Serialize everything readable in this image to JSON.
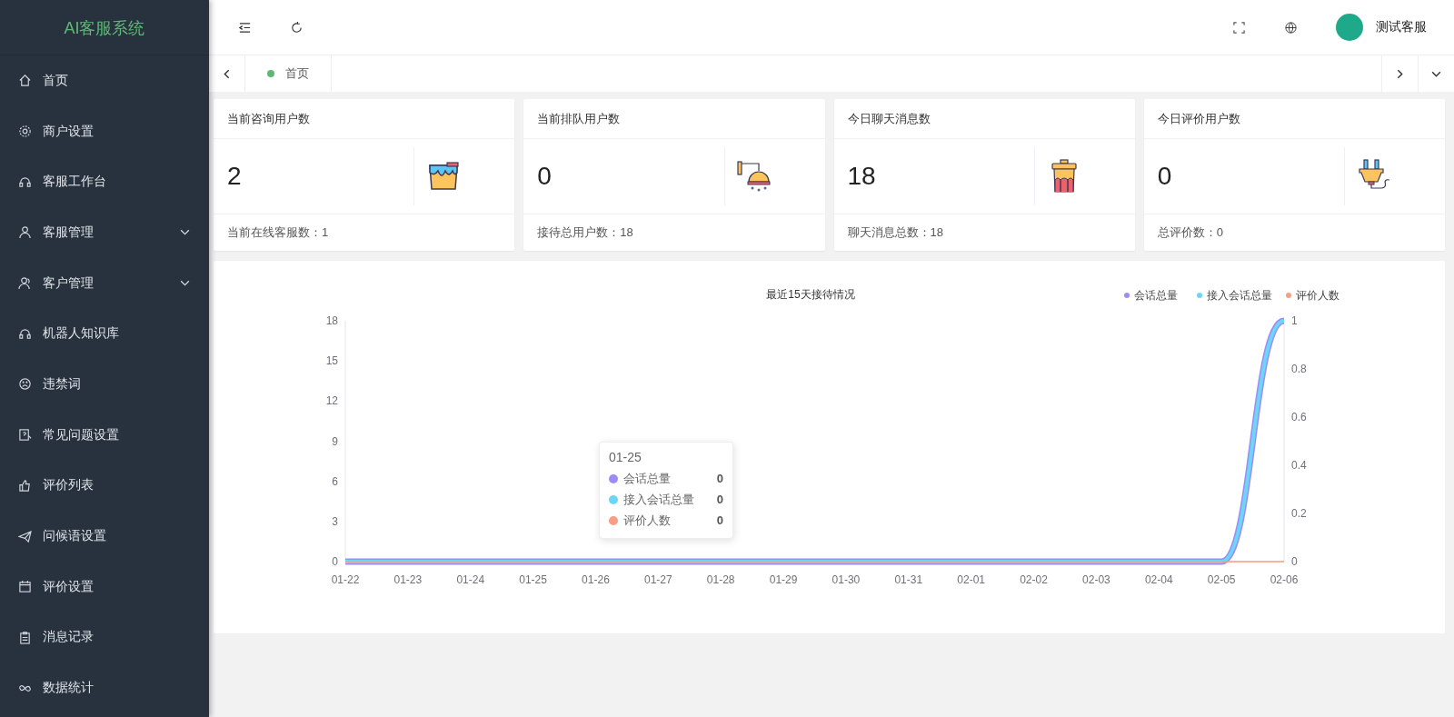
{
  "sidebar": {
    "title": "AI客服系统",
    "items": [
      {
        "label": "首页",
        "expandable": false
      },
      {
        "label": "商户设置",
        "expandable": false
      },
      {
        "label": "客服工作台",
        "expandable": false
      },
      {
        "label": "客服管理",
        "expandable": true
      },
      {
        "label": "客户管理",
        "expandable": true
      },
      {
        "label": "机器人知识库",
        "expandable": false
      },
      {
        "label": "违禁词",
        "expandable": false
      },
      {
        "label": "常见问题设置",
        "expandable": false
      },
      {
        "label": "评价列表",
        "expandable": false
      },
      {
        "label": "问候语设置",
        "expandable": false
      },
      {
        "label": "评价设置",
        "expandable": false
      },
      {
        "label": "消息记录",
        "expandable": false
      },
      {
        "label": "数据统计",
        "expandable": false
      }
    ]
  },
  "header": {
    "user": "测试客服"
  },
  "tabs": [
    {
      "label": "首页",
      "selected": true
    }
  ],
  "cards": [
    {
      "title": "当前咨询用户数",
      "value": "2",
      "footer": "当前在线客服数：1"
    },
    {
      "title": "当前排队用户数",
      "value": "0",
      "footer": "接待总用户数：18"
    },
    {
      "title": "今日聊天消息数",
      "value": "18",
      "footer": "聊天消息总数：18"
    },
    {
      "title": "今日评价用户数",
      "value": "0",
      "footer": "总评价数：0"
    }
  ],
  "chart": {
    "chart_data": {
      "type": "line",
      "title": "最近15天接待情况",
      "legend": "top-right",
      "categories": [
        "01-22",
        "01-23",
        "01-24",
        "01-25",
        "01-26",
        "01-27",
        "01-28",
        "01-29",
        "01-30",
        "01-31",
        "02-01",
        "02-02",
        "02-03",
        "02-04",
        "02-05",
        "02-06"
      ],
      "series": [
        {
          "name": "会话总量",
          "color": "#9d8cf7",
          "values": [
            0,
            0,
            0,
            0,
            0,
            0,
            0,
            0,
            0,
            0,
            0,
            0,
            0,
            0,
            0,
            18
          ]
        },
        {
          "name": "接入会话总量",
          "color": "#6cd6f6",
          "values": [
            0,
            0,
            0,
            0,
            0,
            0,
            0,
            0,
            0,
            0,
            0,
            0,
            0,
            0,
            0,
            18
          ]
        },
        {
          "name": "评价人数",
          "color": "#fb9c86",
          "values": [
            0,
            0,
            0,
            0,
            0,
            0,
            0,
            0,
            0,
            0,
            0,
            0,
            0,
            0,
            0,
            0
          ]
        }
      ],
      "ylim": [
        0,
        18
      ],
      "yticks": [
        0,
        3,
        6,
        9,
        12,
        15,
        18
      ]
    },
    "right_axis": {
      "ticks": [
        "1",
        "0.8",
        "0.6",
        "0.4",
        "0.2",
        "0"
      ]
    },
    "tooltip": {
      "title": "01-25",
      "items": [
        {
          "name": "会话总量",
          "value": "0",
          "color": "#9d8cf7"
        },
        {
          "name": "接入会话总量",
          "value": "0",
          "color": "#6cd6f6"
        },
        {
          "name": "评价人数",
          "value": "0",
          "color": "#fb9c86"
        }
      ]
    }
  }
}
